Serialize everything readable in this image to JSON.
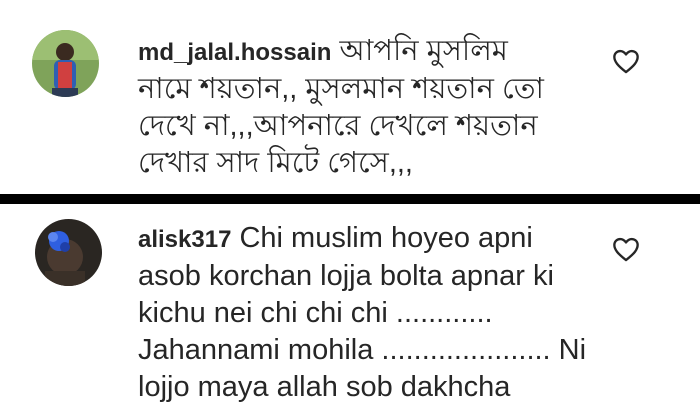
{
  "comments": [
    {
      "username": "md_jalal.hossain",
      "text": "আপনি মুসলিম\nনামে শয়তান,, মুসলমান শয়তান তো\nদেখে না,,,আপনারে দেখলে শয়তান\nদেখার সাদ মিটে গেসে,,,",
      "like_icon": "heart-outline-icon"
    },
    {
      "username": "alisk317",
      "text": "Chi muslim hoyeo apni\nasob korchan lojja bolta apnar ki\nkichu nei chi chi chi ............\nJahannami mohila ..................... Ni\nlojjo maya allah sob dakhcha",
      "like_icon": "heart-outline-icon"
    }
  ]
}
